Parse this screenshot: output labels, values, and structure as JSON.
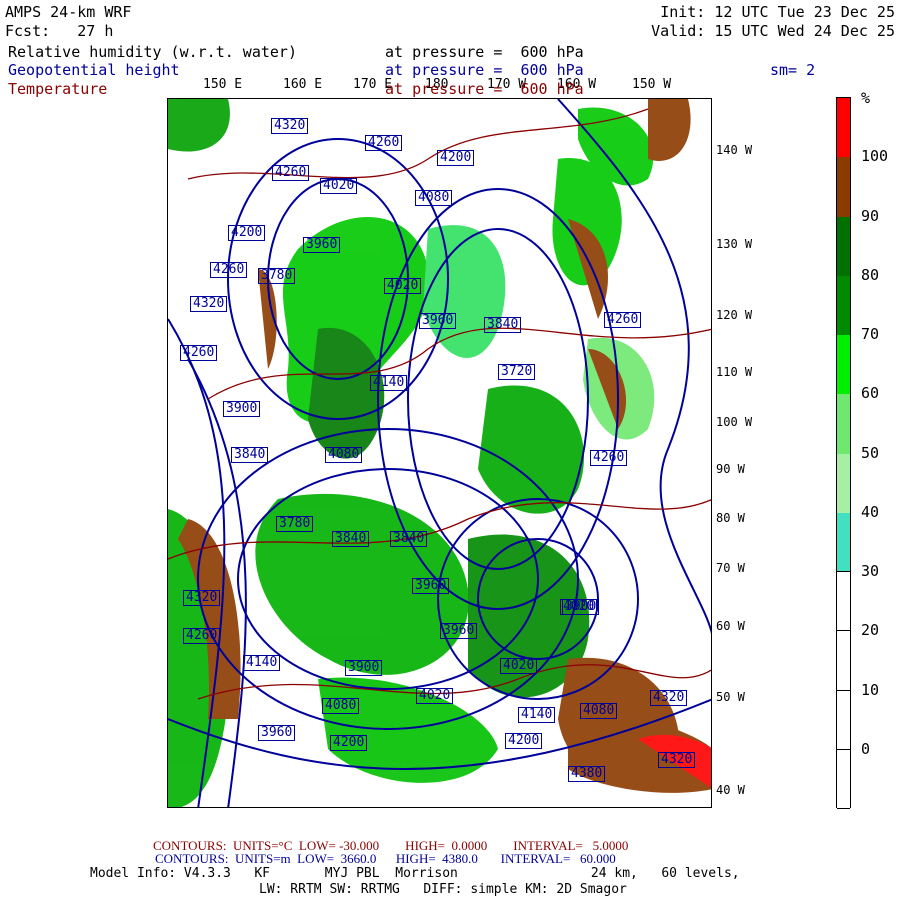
{
  "header": {
    "title": "AMPS 24-km WRF",
    "forecast": "Fcst:   27 h",
    "init": "Init: 12 UTC Tue 23 Dec 25",
    "valid": "Valid: 15 UTC Wed 24 Dec 25",
    "fields": [
      {
        "name": "Relative humidity (w.r.t. water)",
        "level": "at pressure =  600 hPa"
      },
      {
        "name": "Geopotential height",
        "level": "at pressure =  600 hPa"
      },
      {
        "name": "Temperature",
        "level": "at pressure =  600 hPa"
      }
    ],
    "smoothing": "sm= 2"
  },
  "map": {
    "lon_labels": [
      "150 E",
      "160 E",
      "170 E",
      "180",
      "170 W",
      "160 W",
      "150 W"
    ],
    "lat_labels": [
      "140 W",
      "130 W",
      "120 W",
      "110 W",
      "100 W",
      "90 W",
      "80 W",
      "70 W",
      "60 W",
      "50 W",
      "40 W"
    ],
    "height_contour_labels": [
      "4320",
      "4260",
      "4260",
      "4200",
      "4020",
      "4080",
      "4200",
      "4260",
      "4140",
      "3960",
      "4320",
      "4020",
      "4260",
      "3900",
      "3960",
      "3840",
      "4080",
      "4320",
      "4260",
      "4140",
      "3900",
      "4020",
      "4260",
      "3720",
      "4020",
      "3960",
      "3840",
      "3780",
      "3840",
      "3900",
      "3960",
      "4200",
      "4080",
      "3960",
      "4020",
      "4140",
      "4080",
      "4320",
      "4200",
      "4320",
      "4380",
      "4260",
      "3780",
      "3840"
    ],
    "colors": {
      "height": "#00009a",
      "temperature": "#8b0000"
    }
  },
  "colorbar": {
    "unit": "%",
    "labels": [
      "100",
      "90",
      "80",
      "70",
      "60",
      "50",
      "40",
      "30",
      "20",
      "10",
      "0"
    ],
    "colors": [
      "#ff0000",
      "#8b3a00",
      "#007000",
      "#008a00",
      "#00ee00",
      "#70e870",
      "#a6f0a6",
      "#40e0c0",
      "#ffffff",
      "#ffffff",
      "#ffffff",
      "#ffffff"
    ]
  },
  "footer": {
    "temp_contours": "CONTOURS:  UNITS=°C  LOW= -30.000        HIGH=  0.0000        INTERVAL=   5.0000",
    "height_contours": "CONTOURS:  UNITS=m  LOW=  3660.0      HIGH=  4380.0       INTERVAL=   60.000",
    "model_info": "Model Info: V4.3.3   KF       MYJ PBL  Morrison                 24 km,   60 levels,",
    "physics": "LW: RRTM SW: RRTMG   DIFF: simple KM: 2D Smagor"
  }
}
